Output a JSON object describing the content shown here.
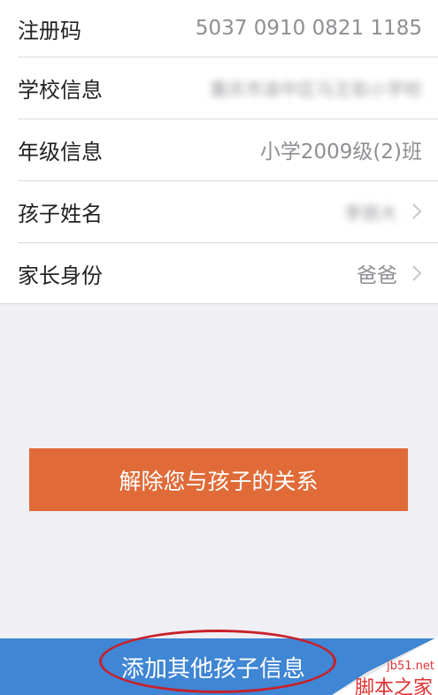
{
  "rows": [
    {
      "label": "注册码",
      "value": "5037 0910 0821 1185"
    },
    {
      "label": "学校信息",
      "value": "重庆市渝中区马王街小学校"
    },
    {
      "label": "年级信息",
      "value": "小学2009级(2)班"
    },
    {
      "label": "孩子姓名",
      "value": "李丽大"
    },
    {
      "label": "家长身份",
      "value": "爸爸"
    }
  ],
  "actions": {
    "unbind_label": "解除您与孩子的关系",
    "add_child_label": "添加其他孩子信息"
  },
  "colors": {
    "unbind_button": "#e06b38",
    "add_bar": "#3f86d4",
    "annotation_ellipse": "#c8202a"
  },
  "icons": {
    "row_chevron": "chevron-right-icon"
  },
  "watermark": {
    "site": "jb51.net",
    "name": "脚本之家"
  }
}
